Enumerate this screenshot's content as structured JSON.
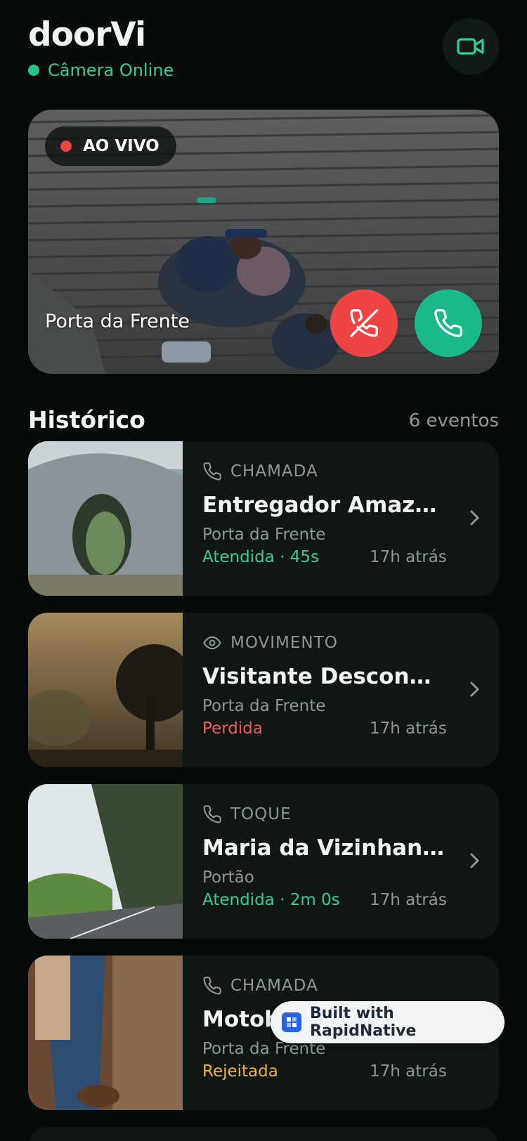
{
  "header": {
    "app_title": "doorVi",
    "status": "Câmera Online",
    "camera_icon": "video-camera-icon"
  },
  "live": {
    "badge": "AO VIVO",
    "location": "Porta da Frente",
    "decline_icon": "phone-off-icon",
    "accept_icon": "phone-icon"
  },
  "history": {
    "title": "Histórico",
    "count": "6 eventos",
    "items": [
      {
        "type": "CHAMADA",
        "type_icon": "phone-icon",
        "title": "Entregador Amazon",
        "location": "Porta da Frente",
        "status": "Atendida · 45s",
        "status_color": "#2fcf95",
        "time": "17h atrás"
      },
      {
        "type": "MOVIMENTO",
        "type_icon": "eye-icon",
        "title": "Visitante Desconhecido",
        "location": "Porta da Frente",
        "status": "Perdida",
        "status_color": "#f05a5a",
        "time": "17h atrás"
      },
      {
        "type": "TOQUE",
        "type_icon": "phone-icon",
        "title": "Maria da Vizinhança",
        "location": "Portão",
        "status": "Atendida · 2m 0s",
        "status_color": "#2fcf95",
        "time": "17h atrás"
      },
      {
        "type": "CHAMADA",
        "type_icon": "phone-icon",
        "title": "Motob",
        "location": "Porta da Frente",
        "status": "Rejeitada",
        "status_color": "#f2b52a",
        "time": "17h atrás"
      }
    ]
  },
  "watermark": "Built with RapidNative"
}
